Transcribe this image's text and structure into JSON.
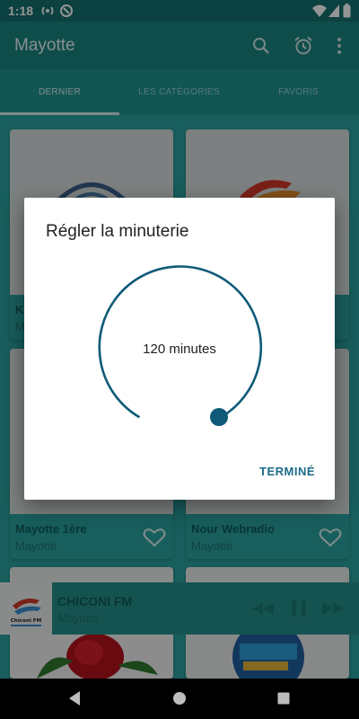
{
  "status_bar": {
    "time": "1:18"
  },
  "app_bar": {
    "title": "Mayotte",
    "actions": [
      "search-icon",
      "alarm-icon",
      "more-vert-icon"
    ]
  },
  "tabs": [
    {
      "label": "DERNIER",
      "active": true
    },
    {
      "label": "LES CATÉGORIES",
      "active": false
    },
    {
      "label": "FAVORIS",
      "active": false
    }
  ],
  "stations": [
    {
      "name": "Ko",
      "region": "Ma"
    },
    {
      "name": "",
      "region": ""
    },
    {
      "name": "Mayotte 1ère",
      "region": "Mayotte"
    },
    {
      "name": "Nour Webradio",
      "region": "Mayotte"
    }
  ],
  "now_playing": {
    "name": "CHICONI FM",
    "region": "Mayotte",
    "logo_text": "Chiconi FM"
  },
  "dialog": {
    "title": "Régler la minuterie",
    "value_text": "120 minutes",
    "done_label": "TERMINÉ"
  },
  "colors": {
    "primary": "#2aa3a0",
    "primary_dark": "#14716f",
    "accent": "#1b6b8a",
    "dial": "#0e5a78"
  }
}
